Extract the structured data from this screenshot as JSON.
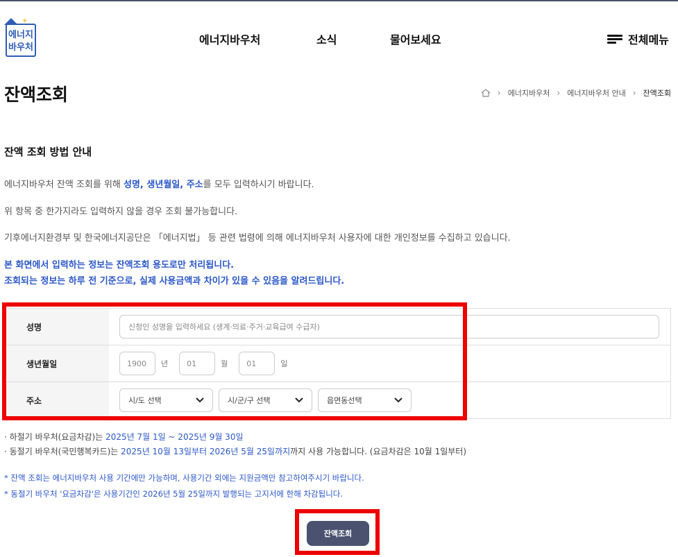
{
  "header": {
    "logo_line1": "에너지",
    "logo_line2": "바우처",
    "nav": [
      "에너지바우처",
      "소식",
      "물어보세요"
    ],
    "all_menu": "전체메뉴"
  },
  "page": {
    "title": "잔액조회",
    "breadcrumb": [
      "에너지바우처",
      "에너지바우처 안내",
      "잔액조회"
    ]
  },
  "guide": {
    "title": "잔액 조회 방법 안내",
    "line1_pre": "에너지바우처 잔액 조회를 위해 ",
    "line1_hl": "성명, 생년월일, 주소",
    "line1_post": "를 모두 입력하시기 바랍니다.",
    "line2": "위 항목 중 한가지라도 입력하지 않을 경우 조회 불가능합니다.",
    "line3": "기후에너지환경부 및 한국에너지공단은 「에너지법」 등 관련 법령에 의해 에너지바우처 사용자에 대한 개인정보를 수집하고 있습니다.",
    "blue1": "본 화면에서 입력하는 정보는 잔액조회 용도로만 처리됩니다.",
    "blue2": "조회되는 정보는 하루 전 기준으로, 실제 사용금액과 차이가 있을 수 있음을 알려드립니다."
  },
  "form": {
    "name_label": "성명",
    "name_placeholder": "신청인 성명을 입력하세요 (생계·의료·주거·교육급여 수급자)",
    "birth_label": "생년월일",
    "year_value": "1900",
    "year_unit": "년",
    "month_value": "01",
    "month_unit": "월",
    "day_value": "01",
    "day_unit": "일",
    "address_label": "주소",
    "sido_selected": "시/도 선택",
    "sigungu_selected": "시/군/구 선택",
    "eupmyeondong_selected": "읍면동선택"
  },
  "notes": {
    "summer_pre": "· 하절기 바우처(요금차감)는 ",
    "summer_hl": "2025년 7월 1일 ~ 2025년 9월 30일",
    "winter_pre": "· 동절기 바우처(국민행복카드)는 ",
    "winter_hl": "2025년 10월 13일부터 2026년 5월 25일까지",
    "winter_post": "까지 사용 가능합니다. (요금차감은 10월 1일부터)",
    "star1": "* 잔액 조회는 에너지바우처 사용 기간에만 가능하며, 사용기간 외에는 지원금액만 참고하여주시기 바랍니다.",
    "star2": "* 동절기 바우처 '요금차감'은 사용기간인 2026년 5월 25일까지 발행되는 고지서에 한해 차감됩니다."
  },
  "submit_label": "잔액조회",
  "colors": {
    "accent": "#2a57c8",
    "button": "#4a5270",
    "highlight_box": "#ee0000"
  }
}
